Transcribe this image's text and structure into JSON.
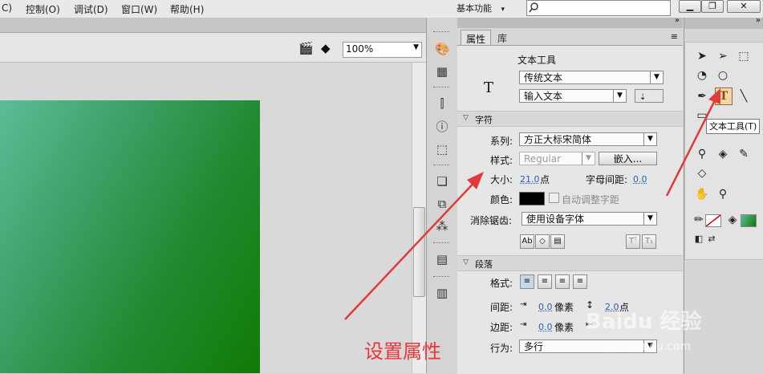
{
  "menubar": {
    "items": [
      "C)",
      "控制(O)",
      "调试(D)",
      "窗口(W)",
      "帮助(H)"
    ],
    "workspace": "基本功能",
    "search_icon": "search-icon",
    "window_buttons": [
      "minimize",
      "restore",
      "close"
    ]
  },
  "stage": {
    "zoom": "100%",
    "canvas_gradient": [
      "#5bbd97",
      "#127a05"
    ]
  },
  "panel": {
    "tabs": [
      "属性",
      "库"
    ],
    "tool_name": "文本工具",
    "text_type": "传统文本",
    "text_mode": "输入文本",
    "char_section": "字符",
    "family_label": "系列:",
    "family_value": "方正大标宋简体",
    "style_label": "样式:",
    "style_value": "Regular",
    "embed_button": "嵌入...",
    "size_label": "大小:",
    "size_value": "21.0",
    "size_unit": "点",
    "letter_spacing_label": "字母间距:",
    "letter_spacing_value": "0.0",
    "color_label": "颜色:",
    "color_value": "#000000",
    "auto_kern": "自动调整字距",
    "antialias_label": "消除锯齿:",
    "antialias_value": "使用设备字体",
    "para_section": "段落",
    "format_label": "格式:",
    "spacing_label": "间距:",
    "spacing_value": "0.0",
    "spacing_unit": "像素",
    "line_spacing_value": "2.0",
    "line_spacing_unit": "点",
    "margin_label": "边距:",
    "margin_value": "0.0",
    "margin_unit": "像素",
    "behavior_label": "行为:",
    "behavior_value": "多行"
  },
  "tools": {
    "tooltip": "文本工具(T)"
  },
  "annotation": {
    "text": "设置属性",
    "color": "#e4363b"
  },
  "watermark": {
    "brand": "Baidu 经验",
    "url": "jingyan.baidu.com"
  }
}
